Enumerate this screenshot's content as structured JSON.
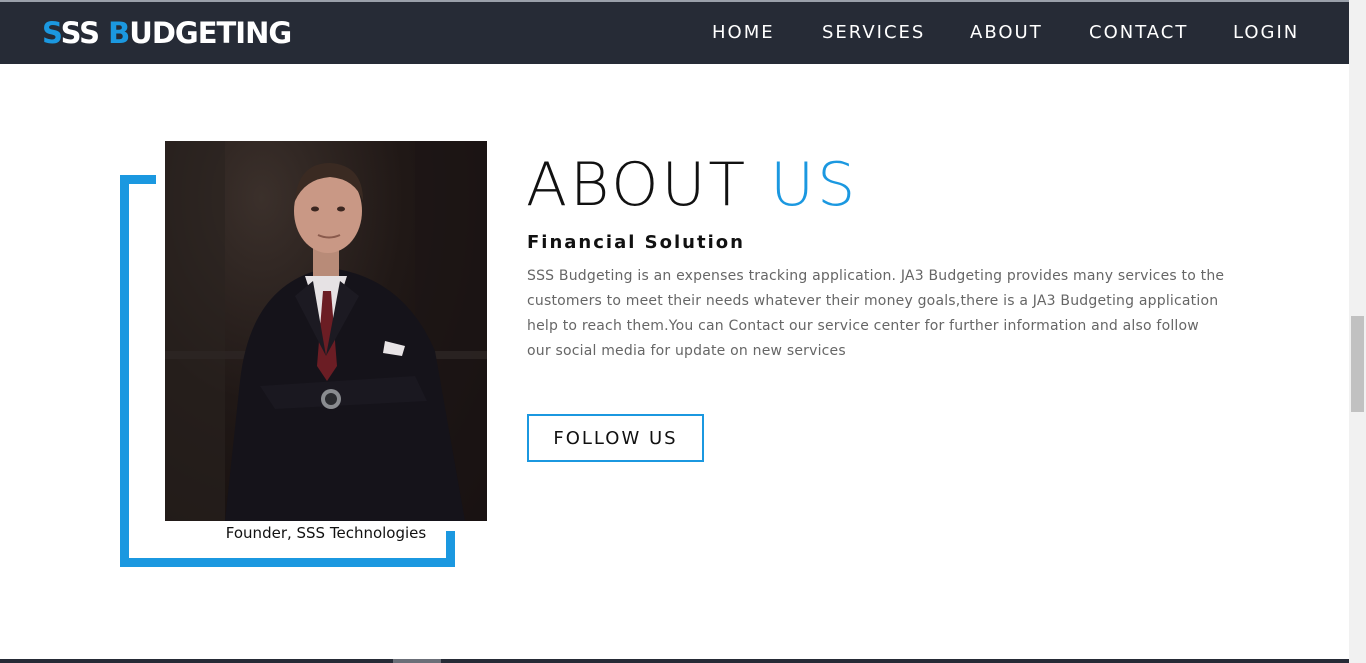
{
  "brand": {
    "first_letter": "S",
    "middle": "SS ",
    "second_letter": "B",
    "rest": "UDGETING"
  },
  "nav": {
    "items": [
      {
        "label": "HOME"
      },
      {
        "label": "SERVICES"
      },
      {
        "label": "ABOUT"
      },
      {
        "label": "CONTACT"
      },
      {
        "label": "LOGIN"
      }
    ]
  },
  "about": {
    "title_main": "ABOUT ",
    "title_accent": "US",
    "subtitle": "Financial Solution",
    "description": "SSS Budgeting is an expenses tracking application. JA3 Budgeting provides many services to the customers to meet their needs whatever their money goals,there is a JA3 Budgeting application help to reach them.You can Contact our service center for further information and also follow our social media for update on new services",
    "follow_button": "FOLLOW US"
  },
  "founder": {
    "caption": "Founder, SSS Technologies"
  },
  "colors": {
    "accent": "#1b98e0",
    "navbar": "#262b36",
    "text_dark": "#111111",
    "text_body": "#666666"
  }
}
